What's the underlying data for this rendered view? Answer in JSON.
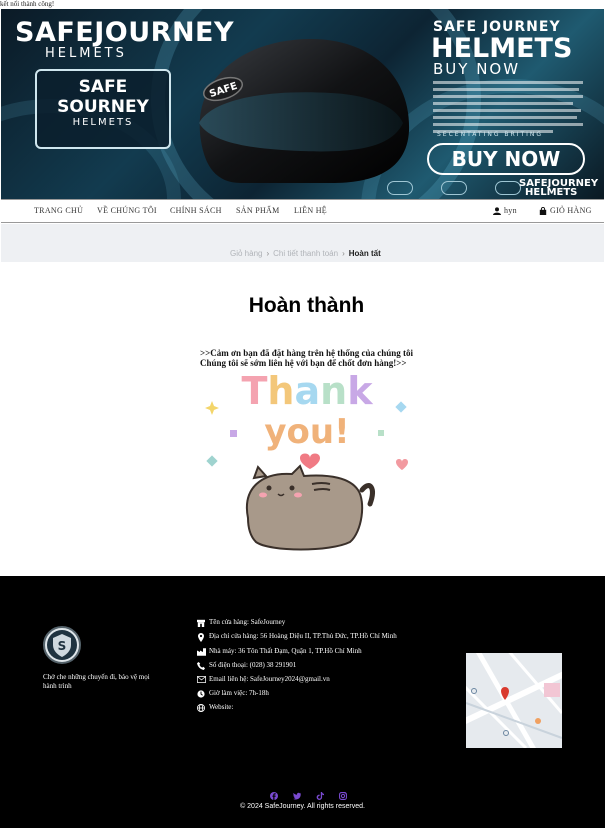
{
  "status": {
    "text": "kết nối thành công!"
  },
  "banner": {
    "brand_title": "SAFEJOURNEY",
    "brand_sub": "HELMETS",
    "badge_line1": "SAFE",
    "badge_line2": "SOURNEY",
    "badge_line3": "HELMETS",
    "helmet_brand": "SAFE",
    "right_line1": "SAFE JOURNEY",
    "right_line2": "HELMETS",
    "right_line3": "BUY NOW",
    "tagline": "SECENTATING BRITING",
    "buy_now": "BUY NOW",
    "small_logo_1": "SAFEJOURNEY",
    "small_logo_2": "HELMETS"
  },
  "nav": {
    "items": [
      "TRANG CHỦ",
      "VỀ CHÚNG TÔI",
      "CHÍNH SÁCH",
      "SẢN PHẨM",
      "LIÊN HỆ"
    ],
    "user": "hyn",
    "cart": "GIỎ HÀNG",
    "user_icon": "user-icon",
    "cart_icon": "shopping-bag-icon"
  },
  "breadcrumb": {
    "items": [
      "Giỏ hàng",
      "Chi tiết thanh toán",
      "Hoàn tất"
    ]
  },
  "main": {
    "title": "Hoàn thành",
    "message_line1": ">>Cảm ơn bạn đã đặt hàng trên hệ thống của chúng tôi",
    "message_line2": "Chúng tôi sẽ sớm liên hệ với bạn để chốt đơn hàng!>>",
    "thanks_line1": "Thank",
    "thanks_line2": "you!"
  },
  "footer": {
    "slogan": "Chở che những chuyến đi, bảo vệ mọi hành trình",
    "store_name": "Tên cửa hàng: SafeJourney",
    "store_address": "Địa chỉ cửa hàng: 56 Hoàng Diệu II, TP.Thủ Đức, TP.Hồ Chí Minh",
    "factory": "Nhà máy: 36 Tôn Thất Đạm, Quận 1, TP.Hồ Chí Minh",
    "phone": "Số điện thoại: (028) 38 291901",
    "email": "Email liên hệ: SafeJourney2024@gmail.vn",
    "hours": "Giờ làm việc: 7h-18h",
    "website": "Website:",
    "social": [
      "facebook-icon",
      "twitter-icon",
      "tiktok-icon",
      "instagram-icon"
    ],
    "copyright": "© 2024 SafeJourney. All rights reserved."
  },
  "colors": {
    "footer_bg": "#000000",
    "social": "#7a4ad1",
    "breadcrumb_band": "#eef0f3"
  }
}
